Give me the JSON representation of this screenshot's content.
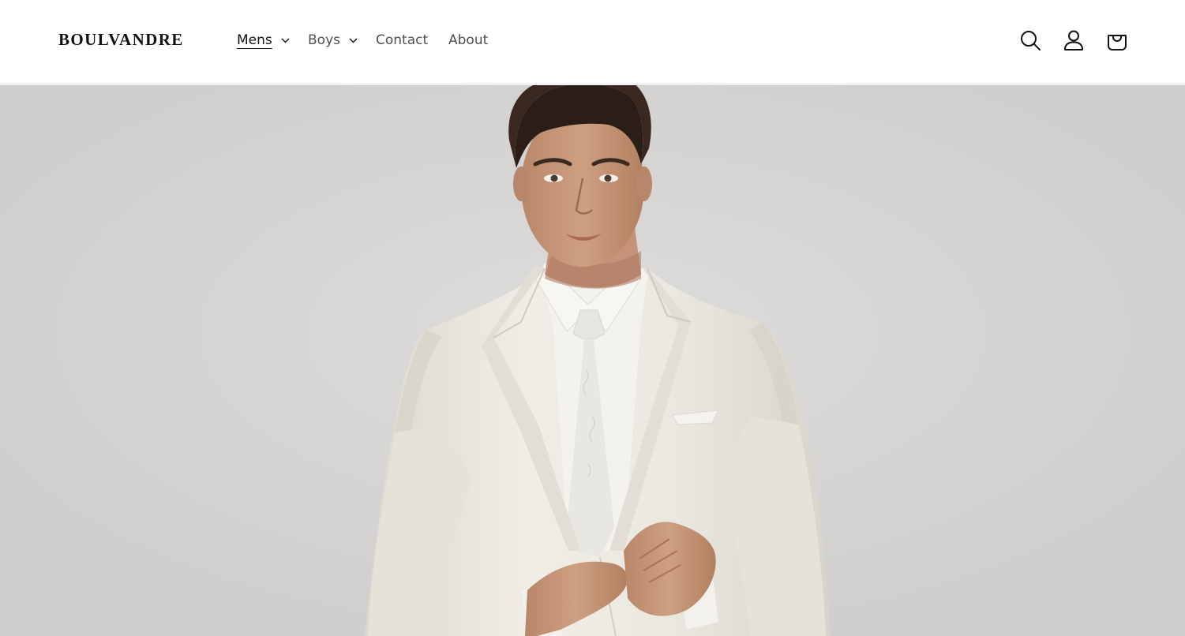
{
  "header": {
    "logo_text": "BOULVANDRE",
    "nav": [
      {
        "label": "Mens",
        "has_dropdown": true,
        "active": true
      },
      {
        "label": "Boys",
        "has_dropdown": true,
        "active": false
      },
      {
        "label": "Contact",
        "has_dropdown": false,
        "active": false
      },
      {
        "label": "About",
        "has_dropdown": false,
        "active": false
      }
    ],
    "icons": [
      "search-icon",
      "account-icon",
      "cart-icon"
    ]
  },
  "hero": {
    "image": "model-in-ivory-suit"
  },
  "colors": {
    "text": "#121212",
    "nav_text": "#4a4a4a",
    "background": "#ffffff",
    "hero_background": "#d4d3d2",
    "suit": "#ece9e2"
  }
}
